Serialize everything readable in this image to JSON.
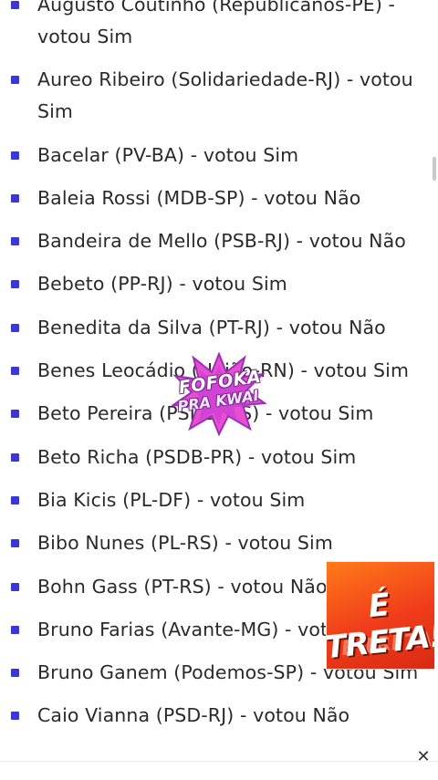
{
  "votes": [
    {
      "text": "Augusto Coutinho (Republicanos-PE) - votou Sim"
    },
    {
      "text": "Aureo Ribeiro (Solidariedade-RJ) - votou Sim"
    },
    {
      "text": "Bacelar (PV-BA) - votou Sim"
    },
    {
      "text": "Baleia Rossi (MDB-SP) - votou Não"
    },
    {
      "text": "Bandeira de Mello (PSB-RJ) - votou Não"
    },
    {
      "text": "Bebeto (PP-RJ) - votou Sim"
    },
    {
      "text": "Benedita da Silva (PT-RJ) - votou Não"
    },
    {
      "text": "Benes Leocádio (União-RN) - votou Sim"
    },
    {
      "text": "Beto Pereira (PSDB-MS) - votou Sim"
    },
    {
      "text": "Beto Richa (PSDB-PR) - votou Sim"
    },
    {
      "text": "Bia Kicis (PL-DF) - votou Sim"
    },
    {
      "text": "Bibo Nunes (PL-RS) - votou Sim"
    },
    {
      "text": "Bohn Gass (PT-RS) - votou Não"
    },
    {
      "text": "Bruno Farias (Avante-MG) - votou Sim"
    },
    {
      "text": "Bruno Ganem (Podemos-SP) - votou Sim"
    },
    {
      "text": "Caio Vianna (PSD-RJ) - votou Não"
    }
  ],
  "stickers": {
    "gossip_line1": "FOFOKA",
    "gossip_line2": "PRA KWAI",
    "drama_text": "É TRETA!",
    "drama_ghost": "É TRETA"
  },
  "ad_close_glyph": "✕",
  "colors": {
    "bullet": "#3b36d6",
    "text": "#2a2a2a",
    "gossip_burst": "#e84fd0",
    "drama_bg": "#f03c1b"
  }
}
